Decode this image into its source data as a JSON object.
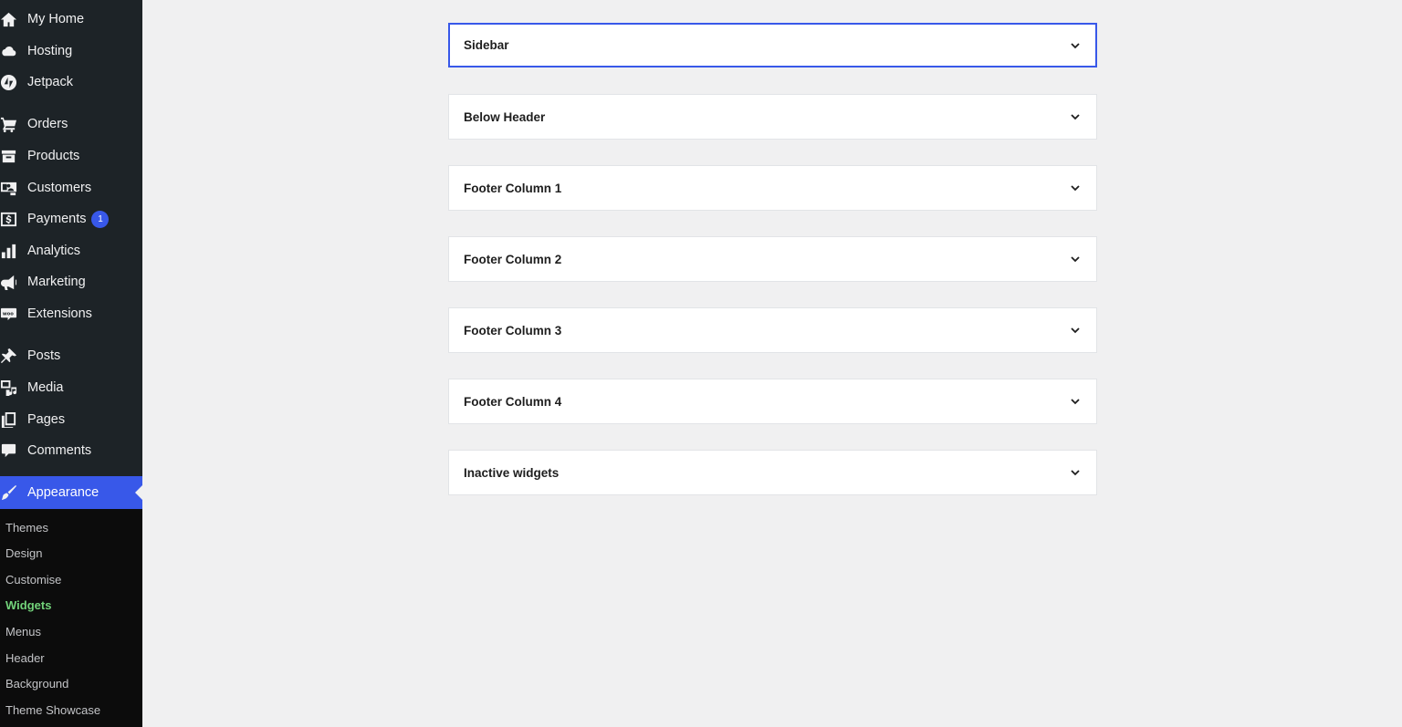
{
  "sidebar": {
    "items": [
      {
        "label": "My Home",
        "icon": "home-icon"
      },
      {
        "label": "Hosting",
        "icon": "cloud-icon"
      },
      {
        "label": "Jetpack",
        "icon": "jetpack-icon"
      },
      {
        "label": "Orders",
        "icon": "cart-icon"
      },
      {
        "label": "Products",
        "icon": "archive-icon"
      },
      {
        "label": "Customers",
        "icon": "customers-icon"
      },
      {
        "label": "Payments",
        "icon": "payments-icon",
        "badge": "1"
      },
      {
        "label": "Analytics",
        "icon": "bar-chart-icon"
      },
      {
        "label": "Marketing",
        "icon": "megaphone-icon"
      },
      {
        "label": "Extensions",
        "icon": "woo-icon"
      },
      {
        "label": "Posts",
        "icon": "pin-icon"
      },
      {
        "label": "Media",
        "icon": "media-icon"
      },
      {
        "label": "Pages",
        "icon": "pages-icon"
      },
      {
        "label": "Comments",
        "icon": "comment-icon"
      },
      {
        "label": "Appearance",
        "icon": "brush-icon",
        "active": true
      }
    ],
    "submenu": [
      {
        "label": "Themes"
      },
      {
        "label": "Design"
      },
      {
        "label": "Customise"
      },
      {
        "label": "Widgets",
        "current": true
      },
      {
        "label": "Menus"
      },
      {
        "label": "Header"
      },
      {
        "label": "Background"
      },
      {
        "label": "Theme Showcase"
      }
    ]
  },
  "widget_areas": [
    {
      "title": "Sidebar",
      "focused": true
    },
    {
      "title": "Below Header"
    },
    {
      "title": "Footer Column 1"
    },
    {
      "title": "Footer Column 2"
    },
    {
      "title": "Footer Column 3"
    },
    {
      "title": "Footer Column 4"
    },
    {
      "title": "Inactive widgets"
    }
  ],
  "colors": {
    "accent": "#3858e9",
    "sidebar_bg": "#1d2327",
    "current_submenu": "#72d37a"
  }
}
